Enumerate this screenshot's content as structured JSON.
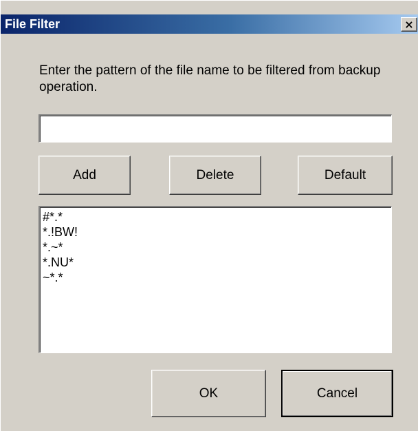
{
  "window": {
    "title": "File Filter",
    "close_label": "×"
  },
  "dialog": {
    "prompt": "Enter the pattern of the file name to be filtered from backup operation.",
    "pattern_input": {
      "value": "",
      "placeholder": ""
    },
    "buttons": {
      "add": "Add",
      "delete": "Delete",
      "default": "Default",
      "ok": "OK",
      "cancel": "Cancel"
    },
    "patterns": [
      "#*.*",
      "*.!BW!",
      "*.~*",
      "*.NU*",
      "~*.*"
    ]
  },
  "colors": {
    "titlebar_start": "#0a246a",
    "titlebar_end": "#a6caf0",
    "face": "#d4d0c8"
  }
}
